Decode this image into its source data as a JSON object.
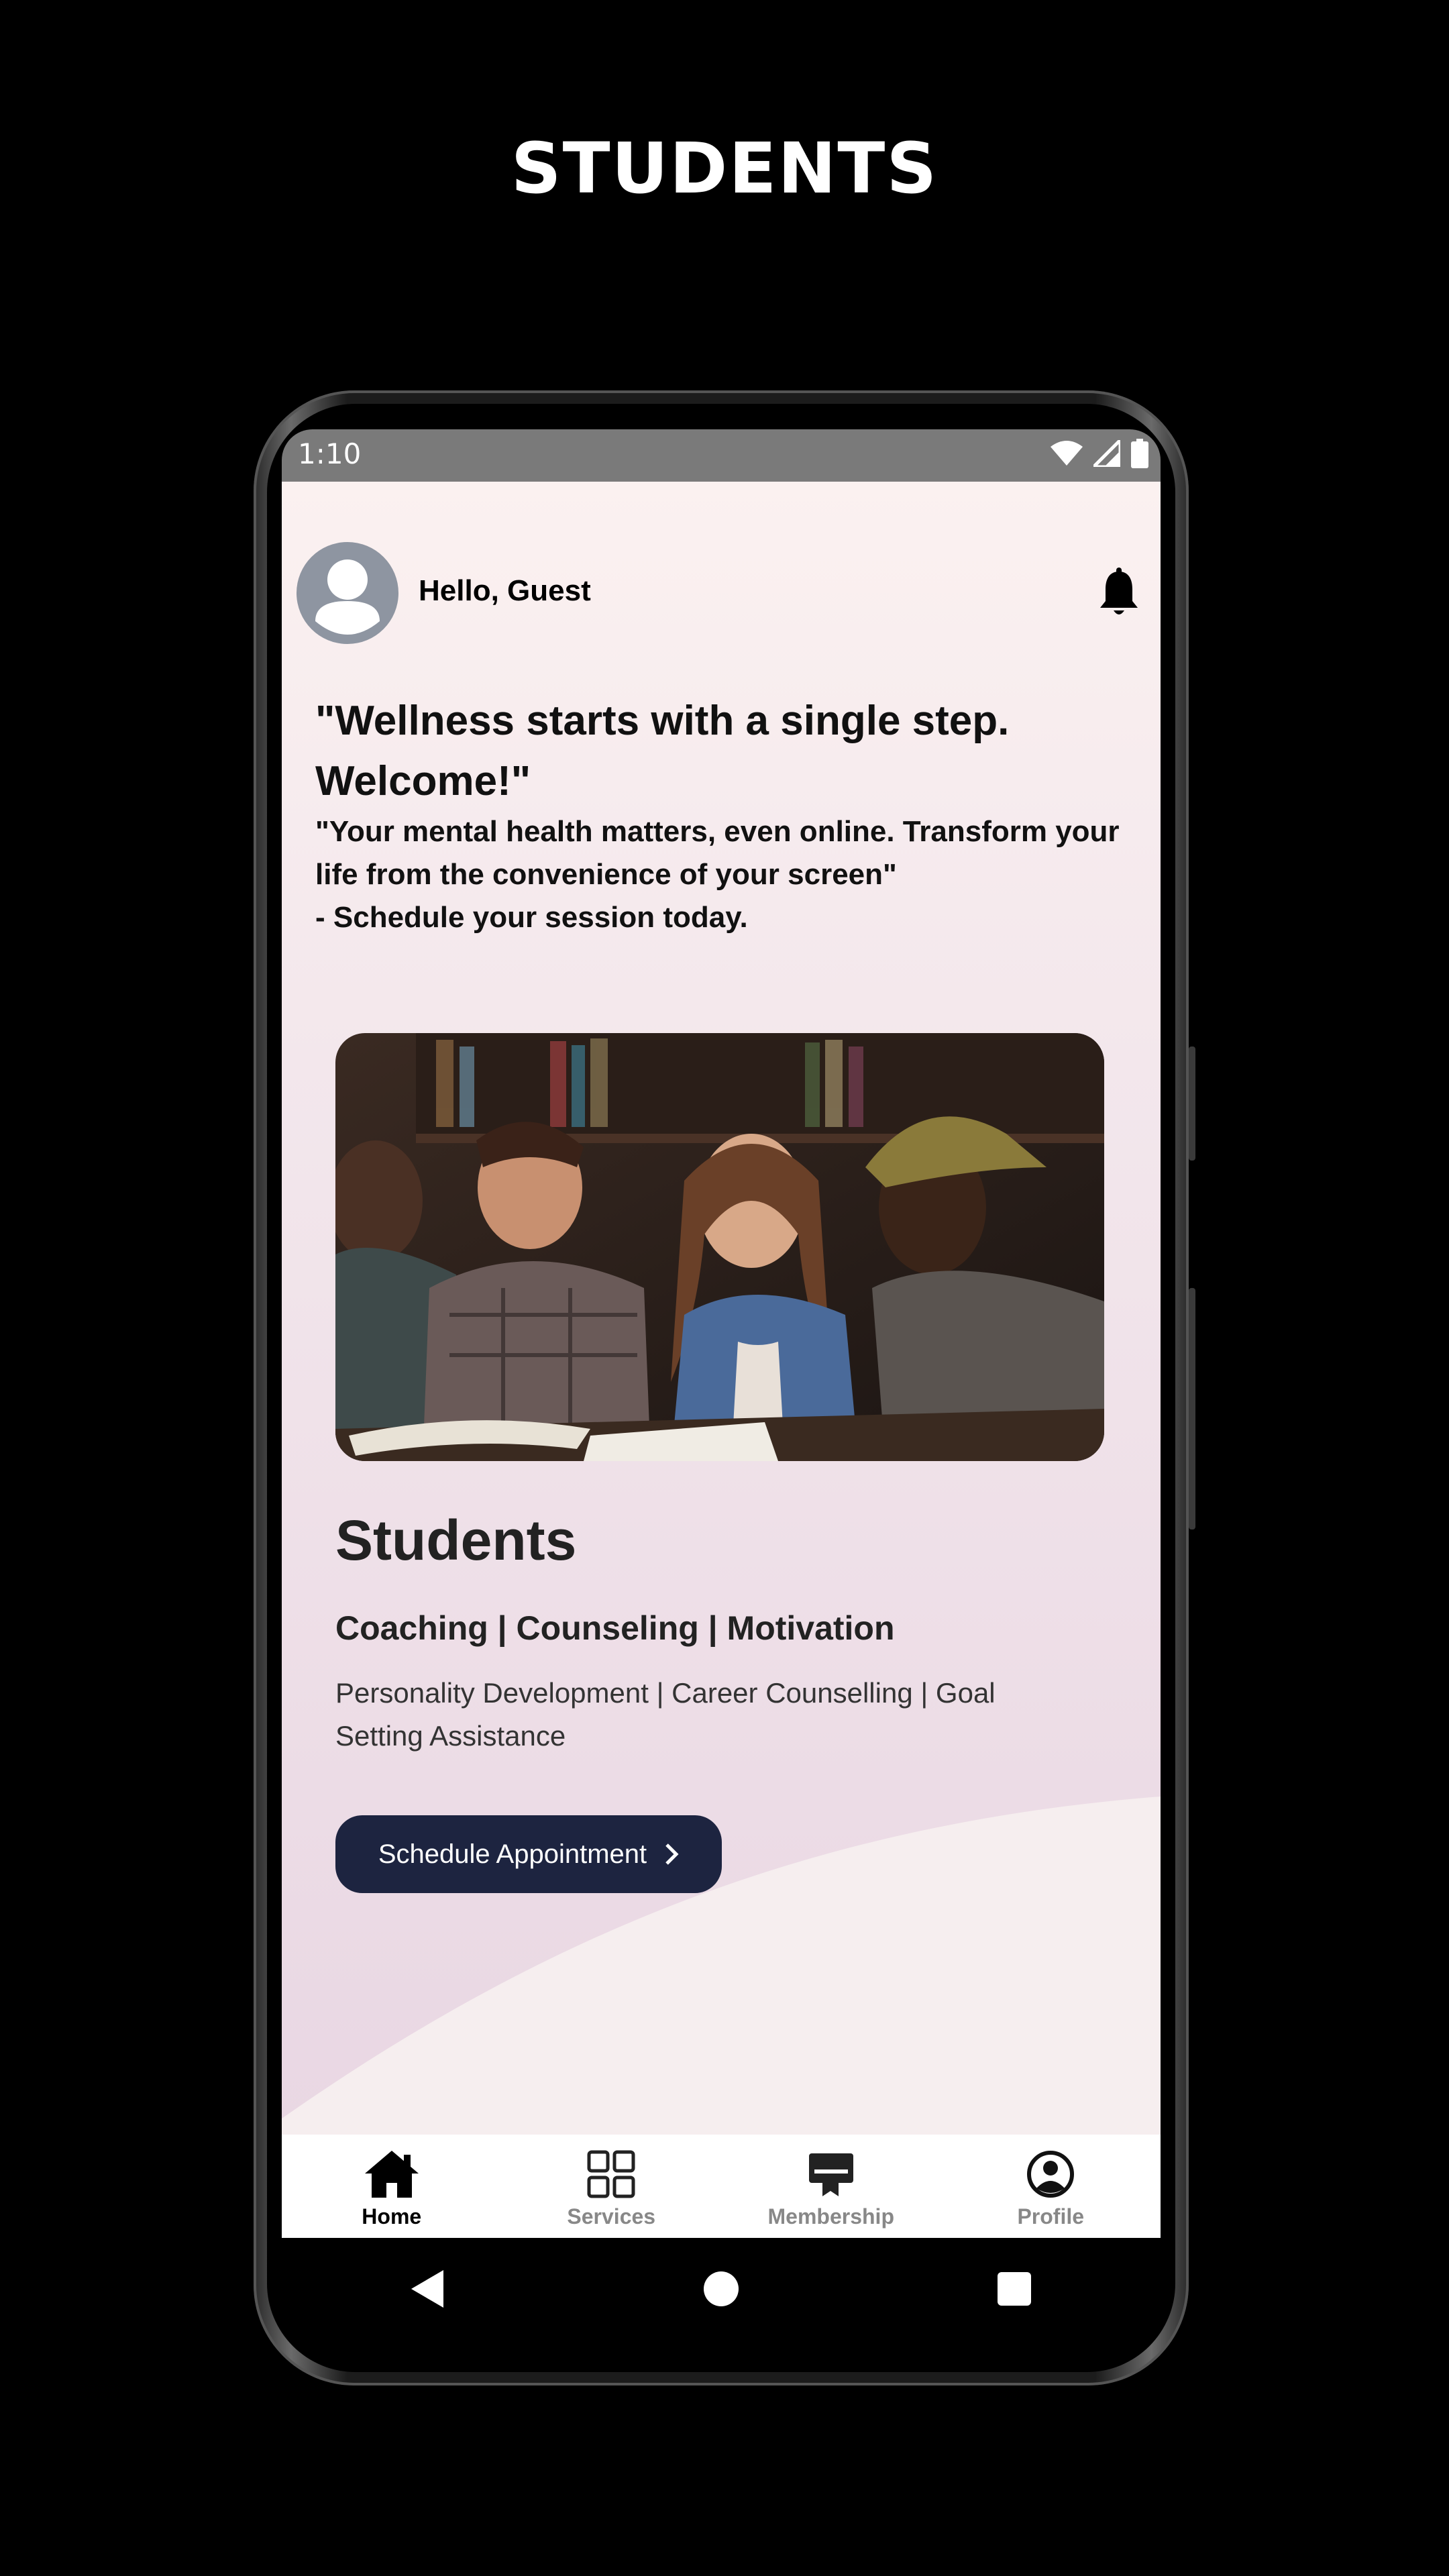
{
  "banner": {
    "title": "STUDENTS"
  },
  "statusbar": {
    "time": "1:10"
  },
  "header": {
    "greeting": "Hello, Guest"
  },
  "hero": {
    "headline": "\"Wellness starts with a single step. Welcome!\"",
    "quote_line1": "\"Your mental health matters, even online. Transform your life from the convenience of your screen\"",
    "quote_line2": "- Schedule your session today."
  },
  "card": {
    "title": "Students",
    "services": "Coaching | Counseling | Motivation",
    "description": "Personality Development | Career Counselling | Goal Setting Assistance",
    "cta_label": "Schedule Appointment"
  },
  "bottom_nav": {
    "items": [
      {
        "label": "Home",
        "icon": "home-icon",
        "active": true
      },
      {
        "label": "Services",
        "icon": "grid-icon",
        "active": false
      },
      {
        "label": "Membership",
        "icon": "membership-card-icon",
        "active": false
      },
      {
        "label": "Profile",
        "icon": "profile-icon",
        "active": false
      }
    ]
  },
  "colors": {
    "background": "#000000",
    "cta": "#1d2440",
    "status_bar": "#7a7a7a",
    "avatar": "#8e95a1"
  }
}
